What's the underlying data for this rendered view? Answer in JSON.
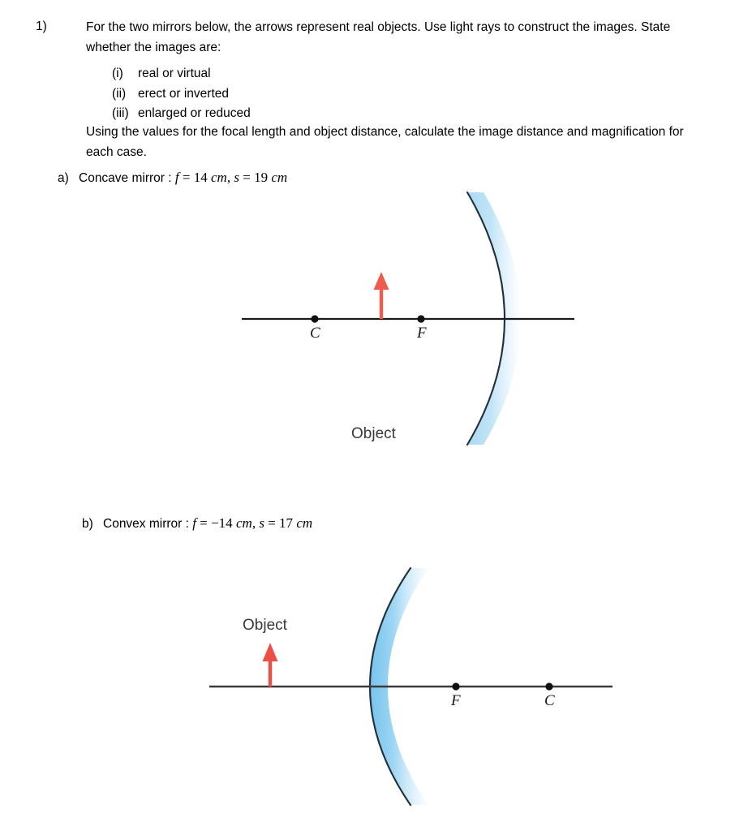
{
  "worksheet": {
    "question_number": "1)",
    "prompt_line": "For the two mirrors below, the arrows represent real objects. Use light rays to construct the images. State whether the images are:",
    "sub_items": [
      {
        "marker": "(i)",
        "text": "real or virtual"
      },
      {
        "marker": "(ii)",
        "text": "erect or inverted"
      },
      {
        "marker": "(iii)",
        "text": "enlarged or reduced"
      }
    ],
    "closing_line": "Using the values for the focal length and object distance, calculate the image distance and magnification for each case.",
    "parts": [
      {
        "marker": "a)",
        "title": "Concave mirror : ",
        "focal_symbol": "f",
        "eq1": " = ",
        "focal_value": "14",
        "focal_unit": "cm",
        "separator": ", ",
        "object_symbol": "s",
        "eq2": " = ",
        "object_value": "19",
        "object_unit": "cm"
      },
      {
        "marker": "b)",
        "title": "Convex mirror : ",
        "focal_symbol": "f",
        "eq1": " = ",
        "focal_value": "−14",
        "focal_unit": "cm",
        "separator": ", ",
        "object_symbol": "s",
        "eq2": " = ",
        "object_value": "17",
        "object_unit": "cm"
      }
    ]
  },
  "diagrams": {
    "concave": {
      "object_label": "Object",
      "center_label": "C",
      "focus_label": "F",
      "mirror_type": "concave",
      "axis_color": "#1a1a1a",
      "arrow_color": "#ef5c4e",
      "mirror_fill_color": "#a6d7f2",
      "mirror_edge_color": "#23303a"
    },
    "convex": {
      "object_label": "Object",
      "center_label": "C",
      "focus_label": "F",
      "mirror_type": "convex",
      "axis_color": "#3a3a3a",
      "arrow_color": "#ee4f44",
      "mirror_fill_color": "#7fc6ef",
      "mirror_edge_color": "#23303a"
    }
  }
}
